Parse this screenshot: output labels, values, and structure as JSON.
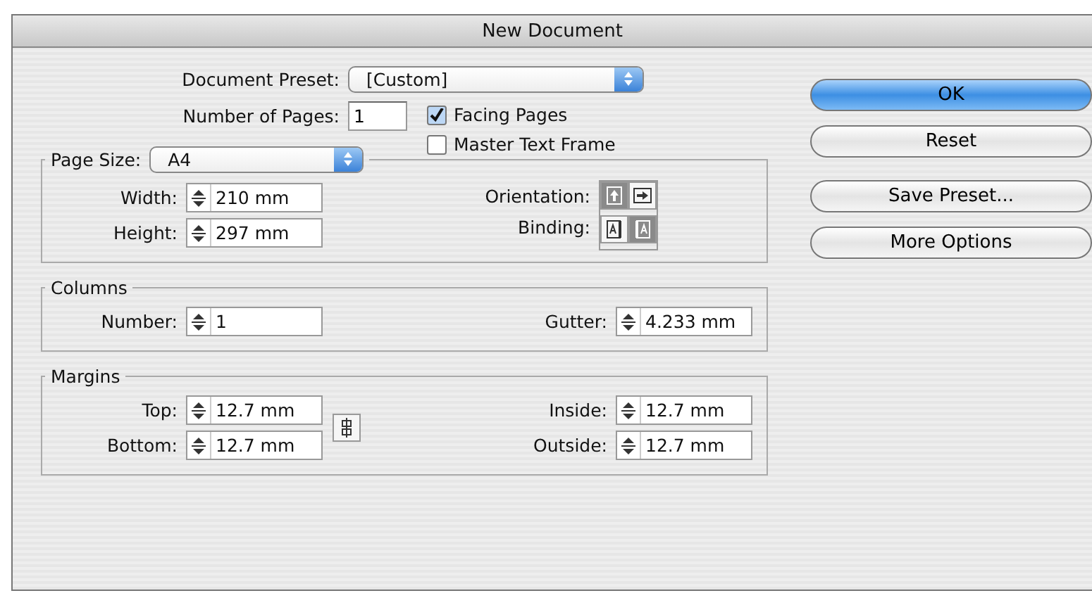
{
  "window": {
    "title": "New Document"
  },
  "document_preset": {
    "label": "Document Preset:",
    "value": "[Custom]"
  },
  "number_of_pages": {
    "label": "Number of Pages:",
    "value": "1"
  },
  "options": [
    {
      "label": "Facing Pages",
      "checked": true
    },
    {
      "label": "Master Text Frame",
      "checked": false
    }
  ],
  "page_size": {
    "label": "Page Size:",
    "value": "A4",
    "fields": [
      {
        "label": "Width:",
        "value": "210 mm"
      },
      {
        "label": "Height:",
        "value": "297 mm"
      }
    ],
    "orientation": {
      "label": "Orientation:",
      "options": [
        {
          "kind": "portrait",
          "selected": true
        },
        {
          "kind": "landscape",
          "selected": false
        }
      ]
    },
    "binding": {
      "label": "Binding:",
      "options": [
        {
          "kind": "left",
          "selected": false
        },
        {
          "kind": "right",
          "selected": true
        }
      ]
    }
  },
  "columns": {
    "title": "Columns",
    "number": {
      "label": "Number:",
      "value": "1"
    },
    "gutter": {
      "label": "Gutter:",
      "value": "4.233 mm"
    }
  },
  "margins": {
    "title": "Margins",
    "left": [
      {
        "label": "Top:",
        "value": "12.7 mm"
      },
      {
        "label": "Bottom:",
        "value": "12.7 mm"
      }
    ],
    "right": [
      {
        "label": "Inside:",
        "value": "12.7 mm"
      },
      {
        "label": "Outside:",
        "value": "12.7 mm"
      }
    ],
    "linked": false
  },
  "buttons": [
    {
      "label": "OK",
      "default": true
    },
    {
      "label": "Reset",
      "default": false
    },
    {
      "label": "Save Preset...",
      "default": false
    },
    {
      "label": "More Options",
      "default": false
    }
  ]
}
